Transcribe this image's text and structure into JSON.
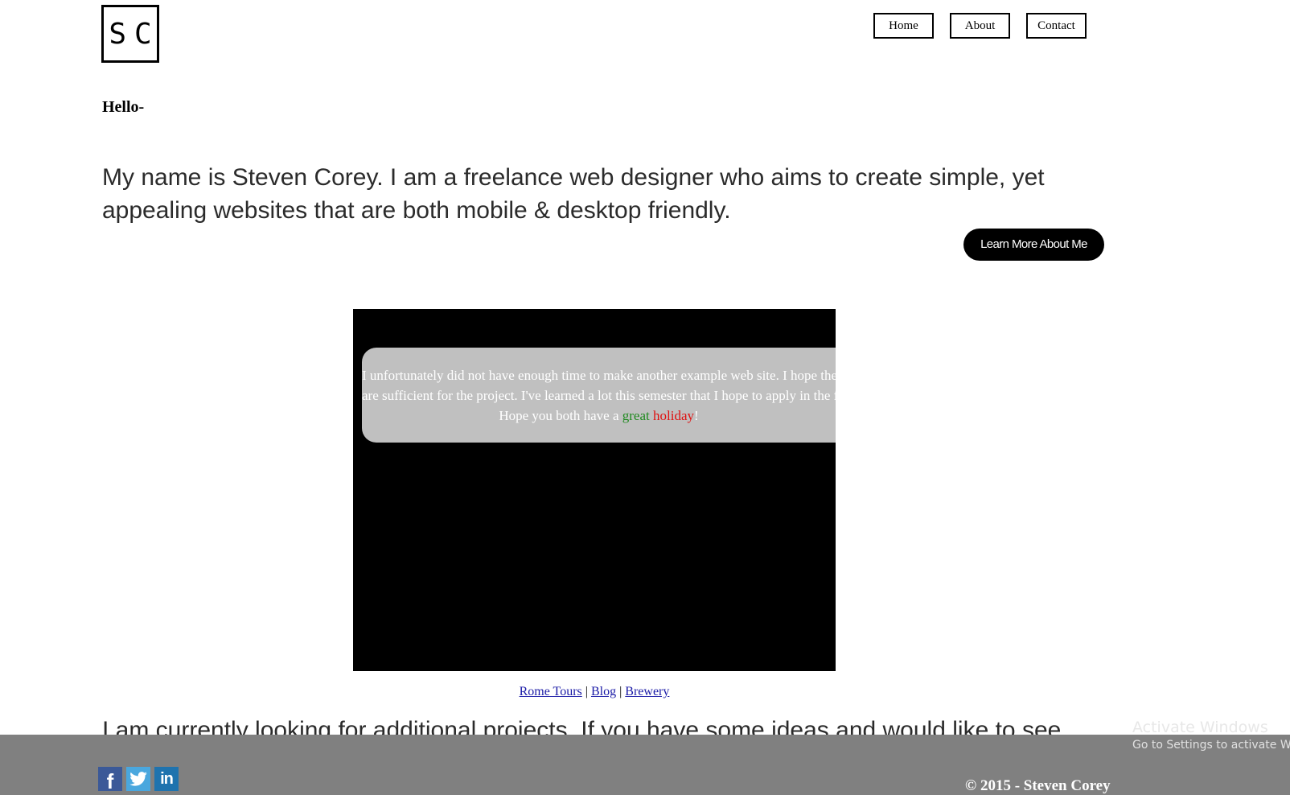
{
  "logo": {
    "text": "SC"
  },
  "nav": {
    "items": [
      {
        "label": "Home"
      },
      {
        "label": "About"
      },
      {
        "label": "Contact"
      }
    ]
  },
  "greeting": "Hello-",
  "intro": "My name is Steven Corey. I am a freelance web designer who aims to create simple, yet appealing websites that are both mobile & desktop friendly.",
  "cta": {
    "label": "Learn More About Me"
  },
  "slide": {
    "line1": "I unfortunately did not have enough time to make another example web site. I hope the others",
    "line2": "are sufficient for the project. I've learned a lot this semester that I hope to apply in the future.",
    "line3_prefix": "Hope you both have a ",
    "line3_green": "great",
    "line3_space": " ",
    "line3_red": "holiday",
    "line3_suffix": "!",
    "colors": {
      "green": "#1f8a1f",
      "red": "#e01010",
      "bubble": "#c0c0c0"
    }
  },
  "project_links": {
    "items": [
      {
        "label": "Rome Tours"
      },
      {
        "label": "Blog"
      },
      {
        "label": "Brewery"
      }
    ],
    "separator": "|"
  },
  "cut_text": "I am currently looking for additional projects. If you have some ideas and would like to see",
  "footer": {
    "social": [
      {
        "icon": "facebook-icon",
        "glyph": "f"
      },
      {
        "icon": "twitter-icon",
        "glyph": "t"
      },
      {
        "icon": "linkedin-icon",
        "glyph": "in"
      }
    ],
    "copyright": "© 2015 - Steven Corey",
    "background": "#808080"
  },
  "os_overlay": {
    "title": "Activate Windows",
    "subtitle": "Go to Settings to activate Windows."
  }
}
